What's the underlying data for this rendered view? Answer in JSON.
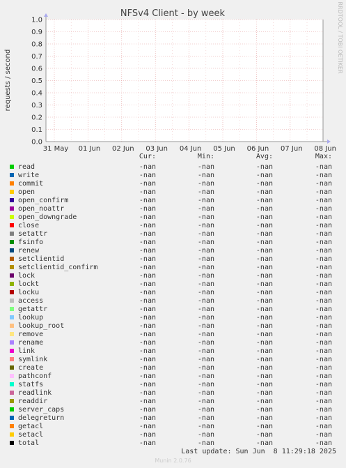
{
  "chart_data": {
    "type": "line",
    "title": "NFSv4 Client - by week",
    "ylabel": "requests / second",
    "xlabel": "",
    "ylim": [
      0,
      1.0
    ],
    "yticks": [
      "0.0",
      "0.1",
      "0.2",
      "0.3",
      "0.4",
      "0.5",
      "0.6",
      "0.7",
      "0.8",
      "0.9",
      "1.0"
    ],
    "xticks": [
      "31 May",
      "01 Jun",
      "02 Jun",
      "03 Jun",
      "04 Jun",
      "05 Jun",
      "06 Jun",
      "07 Jun",
      "08 Jun"
    ],
    "grid": true,
    "legend_placement": "bottom",
    "side_label": "RRDTOOL / TOBI OETIKER",
    "series": [
      {
        "name": "read",
        "color": "#00cc00",
        "cur": "-nan",
        "min": "-nan",
        "avg": "-nan",
        "max": "-nan"
      },
      {
        "name": "write",
        "color": "#0066b3",
        "cur": "-nan",
        "min": "-nan",
        "avg": "-nan",
        "max": "-nan"
      },
      {
        "name": "commit",
        "color": "#ff8000",
        "cur": "-nan",
        "min": "-nan",
        "avg": "-nan",
        "max": "-nan"
      },
      {
        "name": "open",
        "color": "#ffcc00",
        "cur": "-nan",
        "min": "-nan",
        "avg": "-nan",
        "max": "-nan"
      },
      {
        "name": "open_confirm",
        "color": "#330099",
        "cur": "-nan",
        "min": "-nan",
        "avg": "-nan",
        "max": "-nan"
      },
      {
        "name": "open_noattr",
        "color": "#990099",
        "cur": "-nan",
        "min": "-nan",
        "avg": "-nan",
        "max": "-nan"
      },
      {
        "name": "open_downgrade",
        "color": "#ccff00",
        "cur": "-nan",
        "min": "-nan",
        "avg": "-nan",
        "max": "-nan"
      },
      {
        "name": "close",
        "color": "#ff0000",
        "cur": "-nan",
        "min": "-nan",
        "avg": "-nan",
        "max": "-nan"
      },
      {
        "name": "setattr",
        "color": "#808080",
        "cur": "-nan",
        "min": "-nan",
        "avg": "-nan",
        "max": "-nan"
      },
      {
        "name": "fsinfo",
        "color": "#008f00",
        "cur": "-nan",
        "min": "-nan",
        "avg": "-nan",
        "max": "-nan"
      },
      {
        "name": "renew",
        "color": "#00487d",
        "cur": "-nan",
        "min": "-nan",
        "avg": "-nan",
        "max": "-nan"
      },
      {
        "name": "setclientid",
        "color": "#b35a00",
        "cur": "-nan",
        "min": "-nan",
        "avg": "-nan",
        "max": "-nan"
      },
      {
        "name": "setclientid_confirm",
        "color": "#b38f00",
        "cur": "-nan",
        "min": "-nan",
        "avg": "-nan",
        "max": "-nan"
      },
      {
        "name": "lock",
        "color": "#6b006b",
        "cur": "-nan",
        "min": "-nan",
        "avg": "-nan",
        "max": "-nan"
      },
      {
        "name": "lockt",
        "color": "#8fb300",
        "cur": "-nan",
        "min": "-nan",
        "avg": "-nan",
        "max": "-nan"
      },
      {
        "name": "locku",
        "color": "#b30000",
        "cur": "-nan",
        "min": "-nan",
        "avg": "-nan",
        "max": "-nan"
      },
      {
        "name": "access",
        "color": "#bebebe",
        "cur": "-nan",
        "min": "-nan",
        "avg": "-nan",
        "max": "-nan"
      },
      {
        "name": "getattr",
        "color": "#80ff80",
        "cur": "-nan",
        "min": "-nan",
        "avg": "-nan",
        "max": "-nan"
      },
      {
        "name": "lookup",
        "color": "#80c9ff",
        "cur": "-nan",
        "min": "-nan",
        "avg": "-nan",
        "max": "-nan"
      },
      {
        "name": "lookup_root",
        "color": "#ffc080",
        "cur": "-nan",
        "min": "-nan",
        "avg": "-nan",
        "max": "-nan"
      },
      {
        "name": "remove",
        "color": "#ffe680",
        "cur": "-nan",
        "min": "-nan",
        "avg": "-nan",
        "max": "-nan"
      },
      {
        "name": "rename",
        "color": "#aa80ff",
        "cur": "-nan",
        "min": "-nan",
        "avg": "-nan",
        "max": "-nan"
      },
      {
        "name": "link",
        "color": "#ee00cc",
        "cur": "-nan",
        "min": "-nan",
        "avg": "-nan",
        "max": "-nan"
      },
      {
        "name": "symlink",
        "color": "#ff8080",
        "cur": "-nan",
        "min": "-nan",
        "avg": "-nan",
        "max": "-nan"
      },
      {
        "name": "create",
        "color": "#666600",
        "cur": "-nan",
        "min": "-nan",
        "avg": "-nan",
        "max": "-nan"
      },
      {
        "name": "pathconf",
        "color": "#ffbfff",
        "cur": "-nan",
        "min": "-nan",
        "avg": "-nan",
        "max": "-nan"
      },
      {
        "name": "statfs",
        "color": "#00ffcc",
        "cur": "-nan",
        "min": "-nan",
        "avg": "-nan",
        "max": "-nan"
      },
      {
        "name": "readlink",
        "color": "#cc6699",
        "cur": "-nan",
        "min": "-nan",
        "avg": "-nan",
        "max": "-nan"
      },
      {
        "name": "readdir",
        "color": "#999900",
        "cur": "-nan",
        "min": "-nan",
        "avg": "-nan",
        "max": "-nan"
      },
      {
        "name": "server_caps",
        "color": "#00cc00",
        "cur": "-nan",
        "min": "-nan",
        "avg": "-nan",
        "max": "-nan"
      },
      {
        "name": "delegreturn",
        "color": "#0066b3",
        "cur": "-nan",
        "min": "-nan",
        "avg": "-nan",
        "max": "-nan"
      },
      {
        "name": "getacl",
        "color": "#ff8000",
        "cur": "-nan",
        "min": "-nan",
        "avg": "-nan",
        "max": "-nan"
      },
      {
        "name": "setacl",
        "color": "#ffcc00",
        "cur": "-nan",
        "min": "-nan",
        "avg": "-nan",
        "max": "-nan"
      },
      {
        "name": "total",
        "color": "#000000",
        "cur": "-nan",
        "min": "-nan",
        "avg": "-nan",
        "max": "-nan"
      }
    ]
  },
  "legend_headers": {
    "cur": "Cur:",
    "min": "Min:",
    "avg": "Avg:",
    "max": "Max:"
  },
  "last_update": "Last update: Sun Jun  8 11:29:18 2025",
  "footer": "Munin 2.0.76",
  "colors": {
    "background": "#f0f0f0",
    "plot_background": "#ffffff",
    "grid": "#e5a0a0"
  }
}
